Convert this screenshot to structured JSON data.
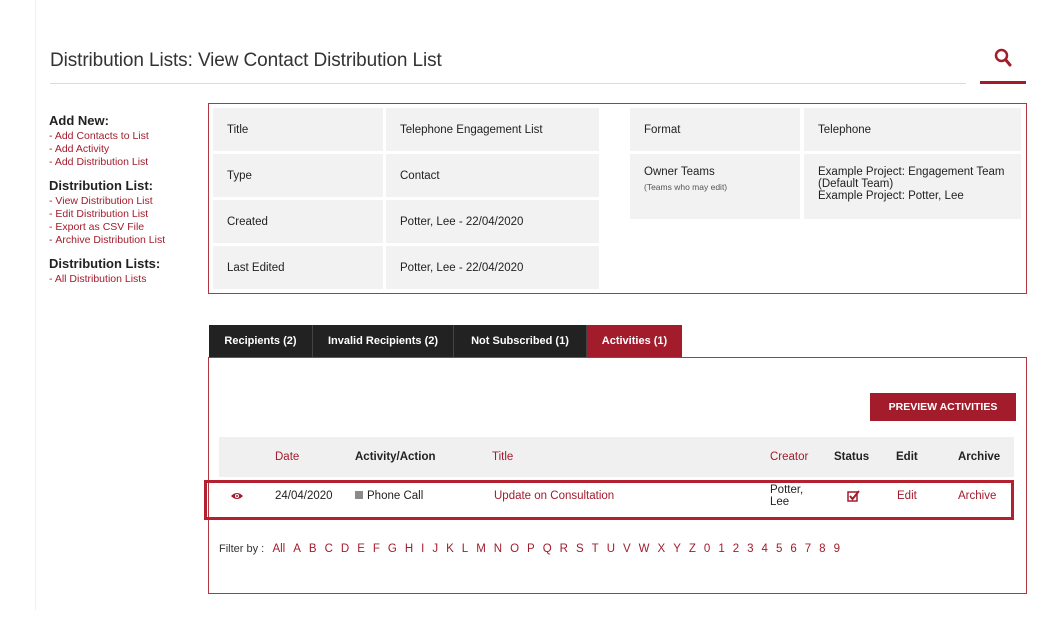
{
  "header": {
    "title": "Distribution Lists: View Contact Distribution List"
  },
  "sidebar": {
    "add_new": {
      "heading": "Add New:",
      "items": [
        "Add Contacts to List",
        "Add Activity",
        "Add Distribution List"
      ]
    },
    "distribution_list": {
      "heading": "Distribution List:",
      "items": [
        "View Distribution List",
        "Edit Distribution List",
        "Export as CSV File",
        "Archive Distribution List"
      ]
    },
    "distribution_lists": {
      "heading": "Distribution Lists:",
      "items": [
        "All Distribution Lists"
      ]
    }
  },
  "details": {
    "title_label": "Title",
    "title_value": "Telephone Engagement List",
    "type_label": "Type",
    "type_value": "Contact",
    "created_label": "Created",
    "created_value": "Potter, Lee - 22/04/2020",
    "last_edited_label": "Last Edited",
    "last_edited_value": "Potter, Lee - 22/04/2020",
    "format_label": "Format",
    "format_value": "Telephone",
    "owner_teams_label": "Owner Teams",
    "owner_teams_sub": "(Teams who may edit)",
    "owner_teams_values": [
      "Example Project: Engagement Team",
      "(Default Team)",
      "Example Project: Potter, Lee"
    ]
  },
  "tabs": [
    {
      "label": "Recipients (2)",
      "active": false
    },
    {
      "label": "Invalid Recipients (2)",
      "active": false
    },
    {
      "label": "Not Subscribed (1)",
      "active": false
    },
    {
      "label": "Activities (1)",
      "active": true
    }
  ],
  "activities": {
    "preview_button": "PREVIEW ACTIVITIES",
    "columns": {
      "date": "Date",
      "activity": "Activity/Action",
      "title": "Title",
      "creator": "Creator",
      "status": "Status",
      "edit": "Edit",
      "archive": "Archive"
    },
    "rows": [
      {
        "date": "24/04/2020",
        "activity": "Phone Call",
        "title": "Update on Consultation",
        "creator_line1": "Potter,",
        "creator_line2": "Lee",
        "edit": "Edit",
        "archive": "Archive"
      }
    ],
    "filter_label": "Filter by :",
    "filter_items": [
      "All",
      "A",
      "B",
      "C",
      "D",
      "E",
      "F",
      "G",
      "H",
      "I",
      "J",
      "K",
      "L",
      "M",
      "N",
      "O",
      "P",
      "Q",
      "R",
      "S",
      "T",
      "U",
      "V",
      "W",
      "X",
      "Y",
      "Z",
      "0",
      "1",
      "2",
      "3",
      "4",
      "5",
      "6",
      "7",
      "8",
      "9"
    ]
  },
  "colors": {
    "accent": "#a31c2c",
    "tab_dark": "#222222",
    "cell_bg": "#f2f2f2"
  }
}
